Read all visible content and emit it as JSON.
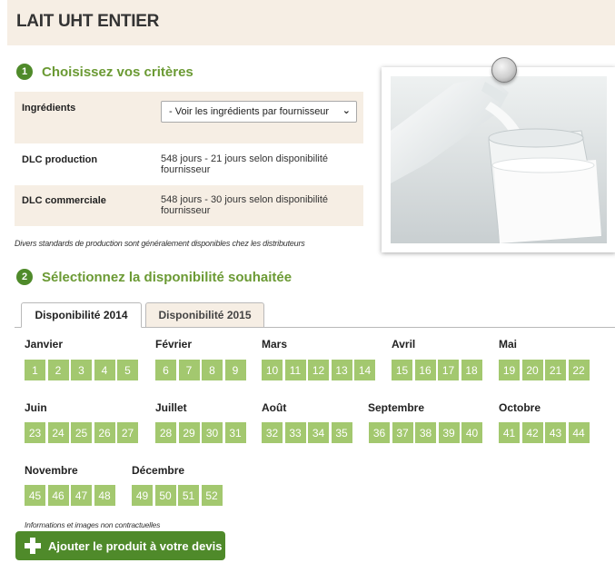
{
  "product": {
    "title": "LAIT UHT ENTIER"
  },
  "step1": {
    "number": "1",
    "title": "Choisissez vos critères"
  },
  "criteria": {
    "ingredients_label": "Ingrédients",
    "ingredients_select": "- Voir les ingrédients par fournisseur",
    "dlc_production_label": "DLC production",
    "dlc_production_value": "548 jours - 21 jours selon disponibilité fournisseur",
    "dlc_commerciale_label": "DLC commerciale",
    "dlc_commerciale_value": "548 jours - 30 jours selon disponibilité fournisseur"
  },
  "standards_note": "Divers standards de production sont généralement disponibles chez les distributeurs",
  "step2": {
    "number": "2",
    "title": "Sélectionnez la disponibilité souhaitée"
  },
  "tabs": [
    "Disponibilité 2014",
    "Disponibilité 2015"
  ],
  "active_tab": "Disponibilité 2014",
  "months": [
    {
      "name": "Janvier",
      "weeks": [
        "1",
        "2",
        "3",
        "4",
        "5"
      ]
    },
    {
      "name": "Février",
      "weeks": [
        "6",
        "7",
        "8",
        "9"
      ]
    },
    {
      "name": "Mars",
      "weeks": [
        "10",
        "11",
        "12",
        "13",
        "14"
      ]
    },
    {
      "name": "Avril",
      "weeks": [
        "15",
        "16",
        "17",
        "18"
      ]
    },
    {
      "name": "Mai",
      "weeks": [
        "19",
        "20",
        "21",
        "22"
      ]
    },
    {
      "name": "Juin",
      "weeks": [
        "23",
        "24",
        "25",
        "26",
        "27"
      ]
    },
    {
      "name": "Juillet",
      "weeks": [
        "28",
        "29",
        "30",
        "31"
      ]
    },
    {
      "name": "Août",
      "weeks": [
        "32",
        "33",
        "34",
        "35"
      ]
    },
    {
      "name": "Septembre",
      "weeks": [
        "36",
        "37",
        "38",
        "39",
        "40"
      ]
    },
    {
      "name": "Octobre",
      "weeks": [
        "41",
        "42",
        "43",
        "44"
      ]
    },
    {
      "name": "Novembre",
      "weeks": [
        "45",
        "46",
        "47",
        "48"
      ]
    },
    {
      "name": "Décembre",
      "weeks": [
        "49",
        "50",
        "51",
        "52"
      ]
    }
  ],
  "info_note": "Informations et images non contractuelles",
  "add_button": "Ajouter le produit à votre devis",
  "colors": {
    "accent_green": "#4f8a2a",
    "title_green": "#6b9a34",
    "week_green": "#a3c86f",
    "panel_beige": "#f6eee4"
  },
  "icons": {
    "pin": "pushpin-icon",
    "add": "plus-icon",
    "select": "chevron-down-icon"
  }
}
